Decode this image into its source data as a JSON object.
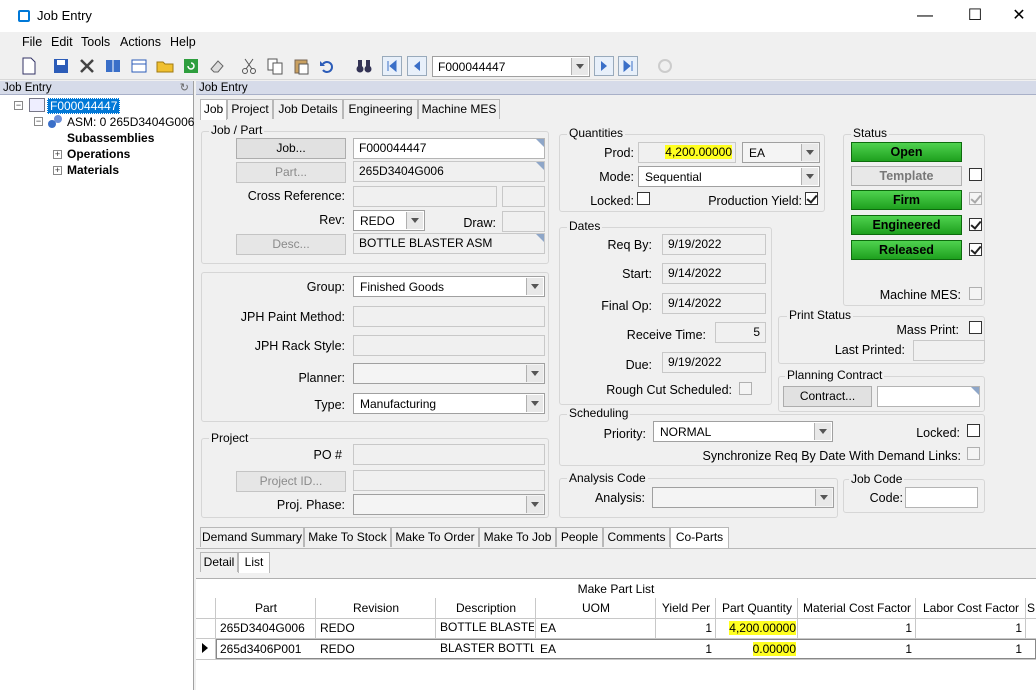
{
  "window": {
    "title": "Job Entry"
  },
  "menu": [
    "File",
    "Edit",
    "Tools",
    "Actions",
    "Help"
  ],
  "toolbar": {
    "job_combo": "F000044447"
  },
  "tree": {
    "header": "Job Entry",
    "root": "F000044447",
    "asm": "ASM: 0 265D3404G006",
    "children": [
      "Subassemblies",
      "Operations",
      "Materials"
    ]
  },
  "main": {
    "header": "Job Entry",
    "tabs": [
      "Job",
      "Project",
      "Job Details",
      "Engineering",
      "Machine MES"
    ],
    "job_part": {
      "title": "Job / Part",
      "job_btn": "Job...",
      "job": "F000044447",
      "part_btn": "Part...",
      "part": "265D3404G006",
      "cross_ref_label": "Cross Reference:",
      "rev_label": "Rev:",
      "rev": "REDO",
      "draw_label": "Draw:",
      "desc_btn": "Desc...",
      "desc": "BOTTLE BLASTER ASM"
    },
    "details": {
      "group_label": "Group:",
      "group": "Finished Goods",
      "paint_label": "JPH Paint Method:",
      "rack_label": "JPH Rack Style:",
      "planner_label": "Planner:",
      "type_label": "Type:",
      "type": "Manufacturing"
    },
    "project": {
      "title": "Project",
      "po_label": "PO #",
      "project_btn": "Project ID...",
      "phase_label": "Proj. Phase:"
    },
    "quantities": {
      "title": "Quantities",
      "prod_label": "Prod:",
      "prod": "4,200.00000",
      "uom": "EA",
      "mode_label": "Mode:",
      "mode": "Sequential",
      "locked_label": "Locked:",
      "prod_yield_label": "Production Yield:"
    },
    "dates": {
      "title": "Dates",
      "req_label": "Req By:",
      "req": "9/19/2022",
      "start_label": "Start:",
      "start": "9/14/2022",
      "final_label": "Final Op:",
      "final": "9/14/2022",
      "receive_label": "Receive Time:",
      "receive": "5",
      "due_label": "Due:",
      "due": "9/19/2022",
      "rough_label": "Rough Cut Scheduled:"
    },
    "status": {
      "title": "Status",
      "open": "Open",
      "template": "Template",
      "firm": "Firm",
      "engineered": "Engineered",
      "released": "Released",
      "machine_mes_label": "Machine MES:"
    },
    "print_status": {
      "title": "Print Status",
      "mass_label": "Mass Print:",
      "last_label": "Last Printed:"
    },
    "planning": {
      "title": "Planning Contract",
      "contract_btn": "Contract..."
    },
    "scheduling": {
      "title": "Scheduling",
      "priority_label": "Priority:",
      "priority": "NORMAL",
      "locked_label": "Locked:",
      "sync_label": "Synchronize Req By Date With Demand Links:"
    },
    "analysis": {
      "title": "Analysis Code",
      "analysis_label": "Analysis:"
    },
    "jobcode": {
      "title": "Job Code",
      "code_label": "Code:"
    },
    "bottom_tabs": [
      "Demand Summary",
      "Make To Stock",
      "Make To Order",
      "Make To Job",
      "People",
      "Comments",
      "Co-Parts"
    ],
    "sub_tabs": [
      "Detail",
      "List"
    ],
    "grid": {
      "caption": "Make Part List",
      "columns": [
        "Part",
        "Revision",
        "Description",
        "UOM",
        "Yield Per",
        "Part Quantity",
        "Material Cost Factor",
        "Labor Cost Factor",
        "S"
      ],
      "rows": [
        [
          "265D3404G006",
          "REDO",
          "BOTTLE BLASTE",
          "EA",
          "1",
          "4,200.00000",
          "1",
          "1"
        ],
        [
          "265d3406P001",
          "REDO",
          "BLASTER BOTTL",
          "EA",
          "1",
          "0.00000",
          "1",
          "1"
        ]
      ]
    }
  },
  "colors": {
    "status_green": "#2bb82b",
    "highlight": "#ffff20",
    "tree_select": "#0078d7"
  }
}
